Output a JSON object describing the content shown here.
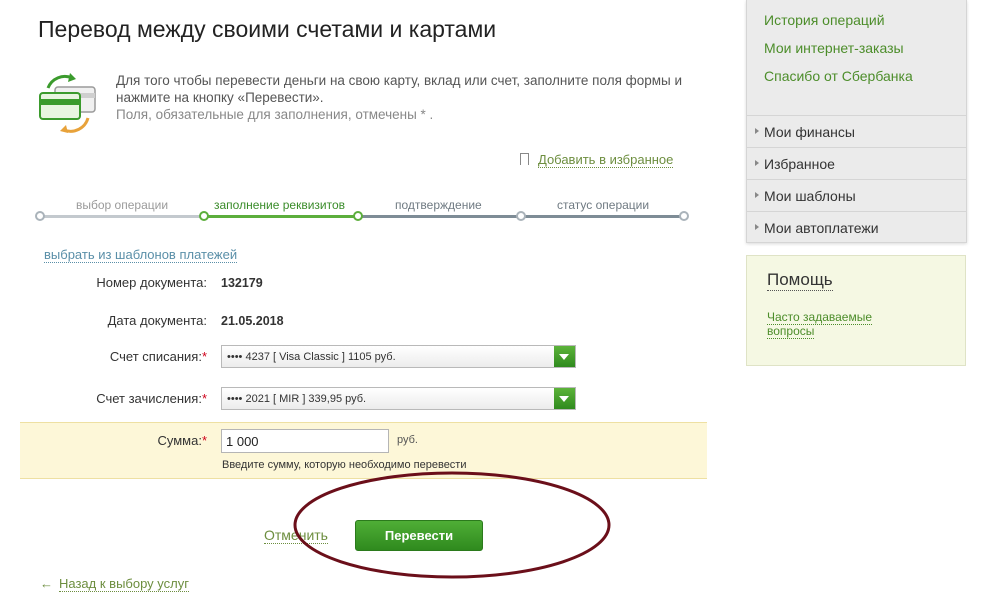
{
  "page": {
    "title": "Перевод между своими счетами и картами",
    "intro_text": "Для того чтобы перевести деньги на свою карту, вклад или счет, заполните поля формы и нажмите на кнопку «Перевести».",
    "intro_required": "Поля, обязательные для заполнения, отмечены * .",
    "add_favorites": "Добавить в избранное"
  },
  "steps": [
    {
      "label": "выбор операции",
      "state": "done"
    },
    {
      "label": "заполнение реквизитов",
      "state": "active"
    },
    {
      "label": "подтверждение",
      "state": "pending"
    },
    {
      "label": "статус операции",
      "state": "pending"
    }
  ],
  "template_link": "выбрать из шаблонов платежей",
  "form": {
    "doc_number_label": "Номер документа:",
    "doc_number_value": "132179",
    "doc_date_label": "Дата документа:",
    "doc_date_value": "21.05.2018",
    "from_label": "Счет списания:",
    "from_value": "•••• 4237   [ Visa Classic ]   1105  руб.",
    "to_label": "Счет зачисления:",
    "to_value": "•••• 2021   [ MIR ] 339,95    руб.",
    "amount_label": "Сумма:",
    "amount_value": "1 000",
    "amount_currency": "руб.",
    "amount_hint": "Введите сумму, которую необходимо перевести",
    "required_mark": "*"
  },
  "actions": {
    "cancel": "Отменить",
    "submit": "Перевести",
    "back": "Назад к выбору услуг"
  },
  "sidebar": {
    "top_links": [
      "История операций",
      "Мои интернет-заказы",
      "Спасибо от Сбербанка"
    ],
    "menu": [
      "Мои финансы",
      "Избранное",
      "Мои шаблоны",
      "Мои автоплатежи"
    ],
    "help_title": "Помощь",
    "help_link": "Часто задаваемые вопросы"
  },
  "colors": {
    "accent_green": "#2f8a1e",
    "link_green": "#4c8d2a",
    "required_red": "#d0021b",
    "annotation_ellipse": "#6b0f1a",
    "amount_band": "#fdf7d8"
  },
  "icons": {
    "intro": "card-transfer-icon",
    "favorites": "bookmark-icon",
    "back": "arrow-left-icon",
    "select": "chevron-down-icon"
  }
}
